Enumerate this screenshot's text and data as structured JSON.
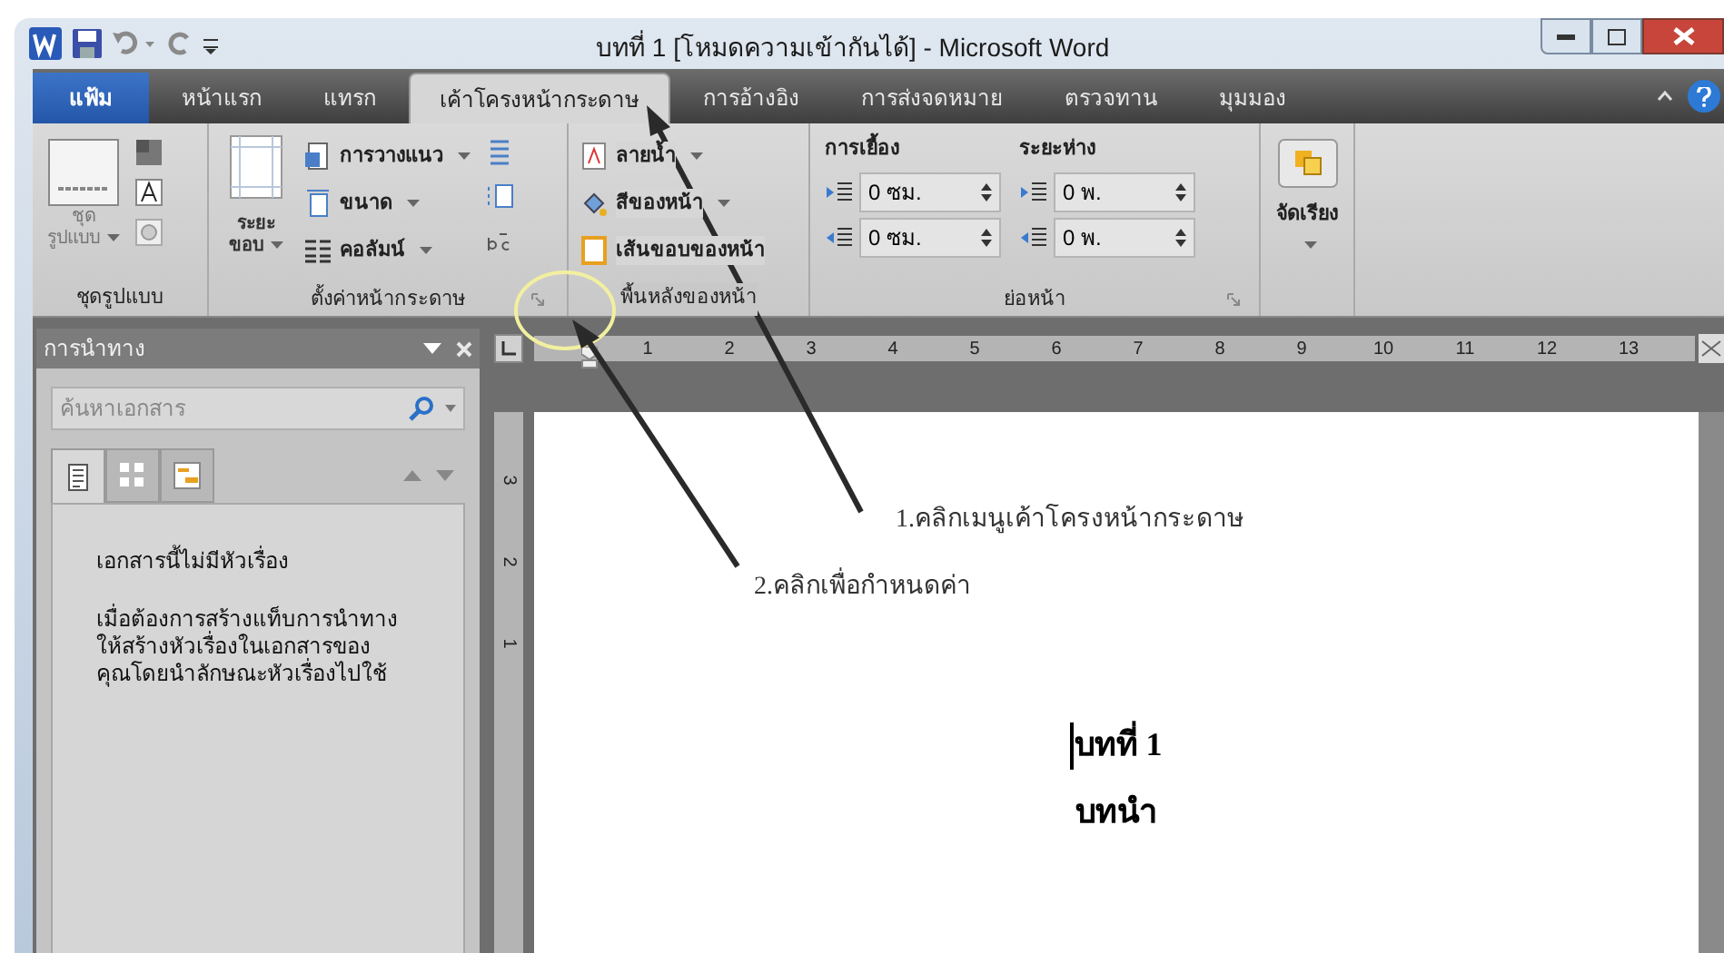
{
  "window": {
    "title": "บทที่ 1 [โหมดความเข้ากันได้] - Microsoft Word"
  },
  "tabs": [
    {
      "label": "แฟ้ม",
      "kind": "file",
      "selected": false
    },
    {
      "label": "หน้าแรก",
      "kind": "tab",
      "selected": false
    },
    {
      "label": "แทรก",
      "kind": "tab",
      "selected": false
    },
    {
      "label": "เค้าโครงหน้ากระดาษ",
      "kind": "tab",
      "selected": true
    },
    {
      "label": "การอ้างอิง",
      "kind": "tab",
      "selected": false
    },
    {
      "label": "การส่งจดหมาย",
      "kind": "tab",
      "selected": false
    },
    {
      "label": "ตรวจทาน",
      "kind": "tab",
      "selected": false
    },
    {
      "label": "มุมมอง",
      "kind": "tab",
      "selected": false
    }
  ],
  "ribbon": {
    "themes": {
      "label": "ชุดรูปแบบ",
      "button": "ชุด\nรูปแบบ"
    },
    "page_setup": {
      "label": "ตั้งค่าหน้ากระดาษ",
      "margins": "ระยะ\nขอบ",
      "commands": [
        "การวางแนว",
        "ขนาด",
        "คอลัมน์"
      ]
    },
    "page_background": {
      "label": "พื้นหลังของหน้า",
      "commands": [
        "ลายน้ำ",
        "สีของหน้า",
        "เส้นขอบของหน้า"
      ]
    },
    "paragraph": {
      "label": "ย่อหน้า",
      "indent": {
        "heading": "การเยื้อง",
        "fields": [
          "0 ซม.",
          "0 ซม."
        ]
      },
      "spacing": {
        "heading": "ระยะห่าง",
        "fields": [
          "0 พ.",
          "0 พ."
        ]
      }
    },
    "arrange": {
      "button": "จัดเรียง"
    }
  },
  "navigation": {
    "title": "การนำทาง",
    "search": {
      "placeholder": "ค้นหาเอกสาร"
    },
    "tabs": [
      {
        "kind": "headings",
        "selected": true
      },
      {
        "kind": "pages",
        "selected": false
      },
      {
        "kind": "results",
        "selected": false
      }
    ],
    "message": "เอกสารนี้ไม่มีหัวเรื่อง",
    "hint": "เมื่อต้องการสร้างแท็บการนำทาง\nให้สร้างหัวเรื่องในเอกสารของ\nคุณโดยนำลักษณะหัวเรื่องไปใช้"
  },
  "ruler": {
    "marks": [
      "1",
      "2",
      "3",
      "4",
      "5",
      "6",
      "7",
      "8",
      "9",
      "10",
      "11",
      "12",
      "13"
    ]
  },
  "vertical_ruler": {
    "marks": [
      "3",
      "2",
      "1"
    ]
  },
  "document": {
    "paragraphs": [
      "บทที่ 1",
      "บทนำ"
    ]
  },
  "annotations": [
    {
      "label": "1.คลิกเมนูเค้าโครงหน้ากระดาษ"
    },
    {
      "label": "2.คลิกเพื่อกำหนดค่า"
    }
  ]
}
